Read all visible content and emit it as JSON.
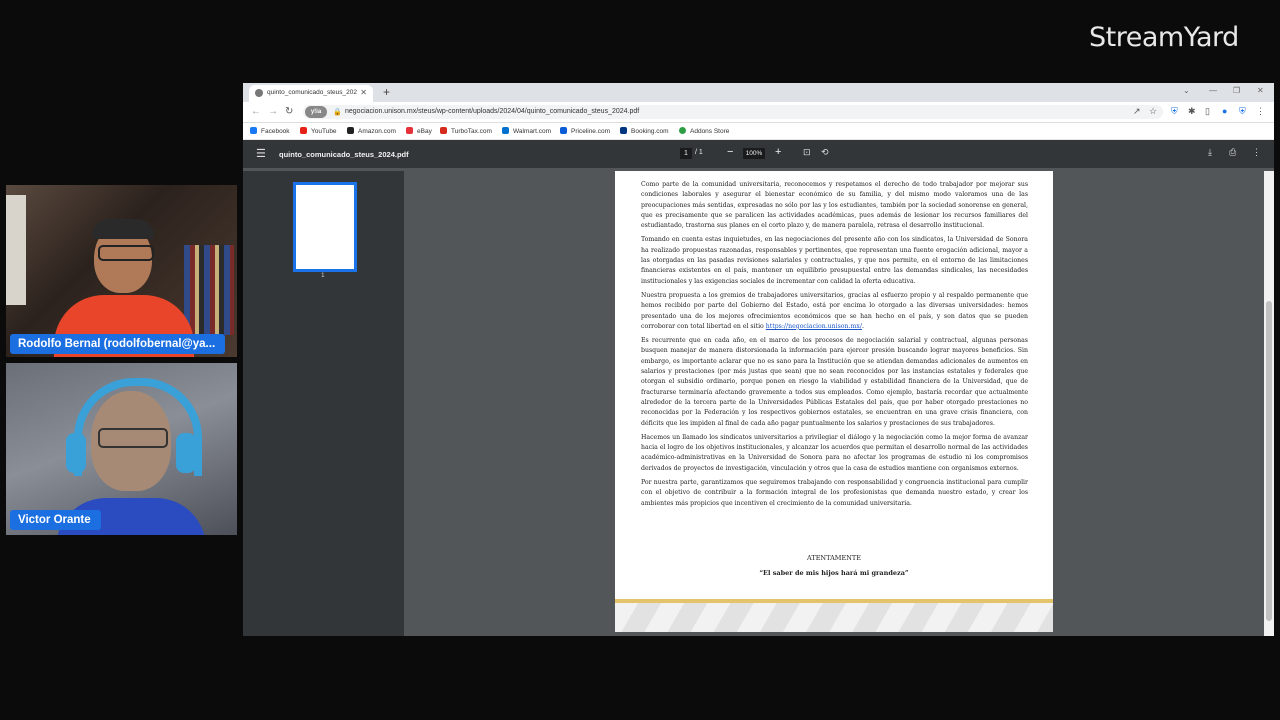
{
  "brand": "StreamYard",
  "participants": [
    {
      "name": "Rodolfo Bernal (rodolfobernal@ya..."
    },
    {
      "name": "Victor Orante"
    }
  ],
  "browser": {
    "tab_title": "quinto_comunicado_steus_2024...",
    "url": "negociacion.unison.mx/steus/wp-content/uploads/2024/04/quinto_comunicado_steus_2024.pdf",
    "profile_chip": "y!ia",
    "bookmarks": [
      {
        "label": "Facebook",
        "color": "#1877f2"
      },
      {
        "label": "YouTube",
        "color": "#e62117"
      },
      {
        "label": "Amazon.com",
        "color": "#222222"
      },
      {
        "label": "eBay",
        "color": "#e53238"
      },
      {
        "label": "TurboTax.com",
        "color": "#d52b1e"
      },
      {
        "label": "Walmart.com",
        "color": "#0071ce"
      },
      {
        "label": "Priceline.com",
        "color": "#0a5cd6"
      },
      {
        "label": "Booking.com",
        "color": "#003580"
      },
      {
        "label": "Addons Store",
        "color": "#2e9e44"
      }
    ]
  },
  "pdf": {
    "filename": "quinto_comunicado_steus_2024.pdf",
    "page_current": "1",
    "page_total": "/ 1",
    "zoom": "100%",
    "thumb_label": "1",
    "paragraphs": [
      "Como parte de la comunidad universitaria, reconocemos y respetamos el derecho de todo trabajador por mejorar sus condiciones laborales y asegurar el bienestar económico de su familia, y del mismo modo valoramos una de las preocupaciones más sentidas, expresadas no sólo por las y los estudiantes, también por la sociedad sonorense en general, que es precisamente que se paralicen las actividades académicas, pues además de lesionar los recursos familiares del estudiantado, trastorna sus planes en el corto plazo y, de manera paralela, retrasa el desarrollo institucional.",
      "Tomando en cuenta estas inquietudes, en las negociaciones del presente año con los sindicatos, la Universidad de Sonora ha realizado propuestas razonadas, responsables y pertinentes, que representan una fuente erogación adicional, mayor a las otorgadas en las pasadas revisiones salariales y contractuales, y que nos permite, en el entorno de las limitaciones financieras existentes en el país, mantener un equilibrio presupuestal entre las demandas sindicales, las necesidades institucionales y las exigencias sociales de incrementar con calidad la oferta educativa.",
      "Nuestra propuesta a los gremios de trabajadores universitarios, gracias al esfuerzo propio y al respaldo permanente que hemos recibido por parte del Gobierno del Estado, está por encima lo otorgado a las diversas universidades: hemos presentado una de los mejores ofrecimientos económicos que se han hecho en el país, y son datos que se pueden corroborar con total libertad en el sitio",
      "Es recurrente que en cada año, en el marco de los procesos de negociación salarial y contractual, algunas personas busquen manejar de manera distorsionada la información para ejercer presión buscando lograr mayores beneficios. Sin embargo, es importante aclarar que no es sano para la Institución que se atiendan demandas adicionales de aumentos en salarios y prestaciones (por más justas que sean) que no sean reconocidos por las instancias estatales y federales que otorgan el subsidio ordinario, porque ponen en riesgo la viabilidad y estabilidad financiera de la Universidad, que de fracturarse terminaría afectando gravemente a todos sus empleados. Como ejemplo, bastaría recordar que actualmente alrededor de la tercera parte de la Universidades Públicas Estatales del país, que por haber otorgado prestaciones no reconocidas por la Federación y los respectivos gobiernos estatales, se encuentran en una grave crisis financiera, con déficits que les impiden al final de cada año pagar puntualmente los salarios y prestaciones de sus trabajadores.",
      "Hacemos un llamado los sindicatos universitarios a privilegiar el diálogo y la negociación como la mejor forma de avanzar hacia el logro de los objetivos institucionales, y alcanzar los acuerdos que permitan el desarrollo normal de las actividades académico-administrativas en la Universidad de Sonora para no afectar los programas de estudio ni los compromisos derivados de proyectos de investigación, vinculación y otros que la casa de estudios mantiene con organismos externos.",
      "Por nuestra parte, garantizamos que seguiremos trabajando con responsabilidad y congruencia institucional para cumplir con el objetivo de contribuir a la formación integral de los profesionistas que demanda nuestro estado, y crear los ambientes más propicios que incentiven el crecimiento de la comunidad universitaria."
    ],
    "link_text": "https://negociacion.unison.mx/",
    "link_suffix": ".",
    "closing": "ATENTAMENTE",
    "motto": "“El saber de mis hijos hará mi grandeza”"
  }
}
